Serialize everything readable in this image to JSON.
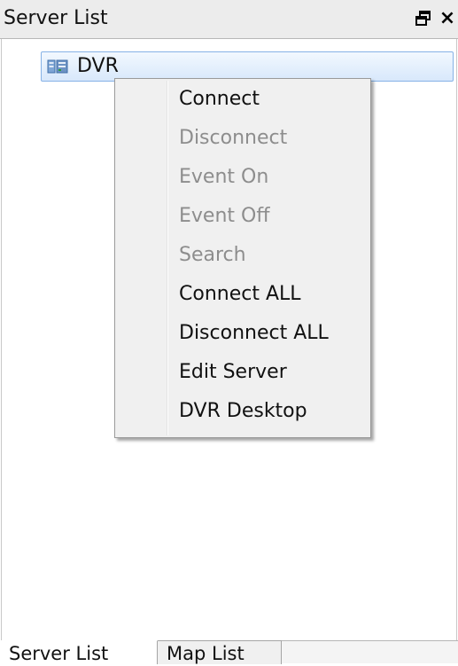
{
  "panel": {
    "title": "Server List"
  },
  "tree": {
    "node_label": "DVR"
  },
  "context_menu": {
    "items": [
      {
        "label": "Connect",
        "enabled": true
      },
      {
        "label": "Disconnect",
        "enabled": false
      },
      {
        "label": "Event On",
        "enabled": false
      },
      {
        "label": "Event Off",
        "enabled": false
      },
      {
        "label": "Search",
        "enabled": false
      },
      {
        "label": "Connect ALL",
        "enabled": true
      },
      {
        "label": "Disconnect ALL",
        "enabled": true
      },
      {
        "label": "Edit Server",
        "enabled": true
      },
      {
        "label": "DVR Desktop",
        "enabled": true
      }
    ]
  },
  "tabs": [
    {
      "label": "Server List",
      "active": true
    },
    {
      "label": "Map List",
      "active": false
    }
  ],
  "icons": {
    "float": "float-window-icon",
    "close": "close-icon",
    "node": "server-icon"
  },
  "colors": {
    "selection_border": "#86b2e6",
    "disabled_text": "#8d8d8d"
  }
}
